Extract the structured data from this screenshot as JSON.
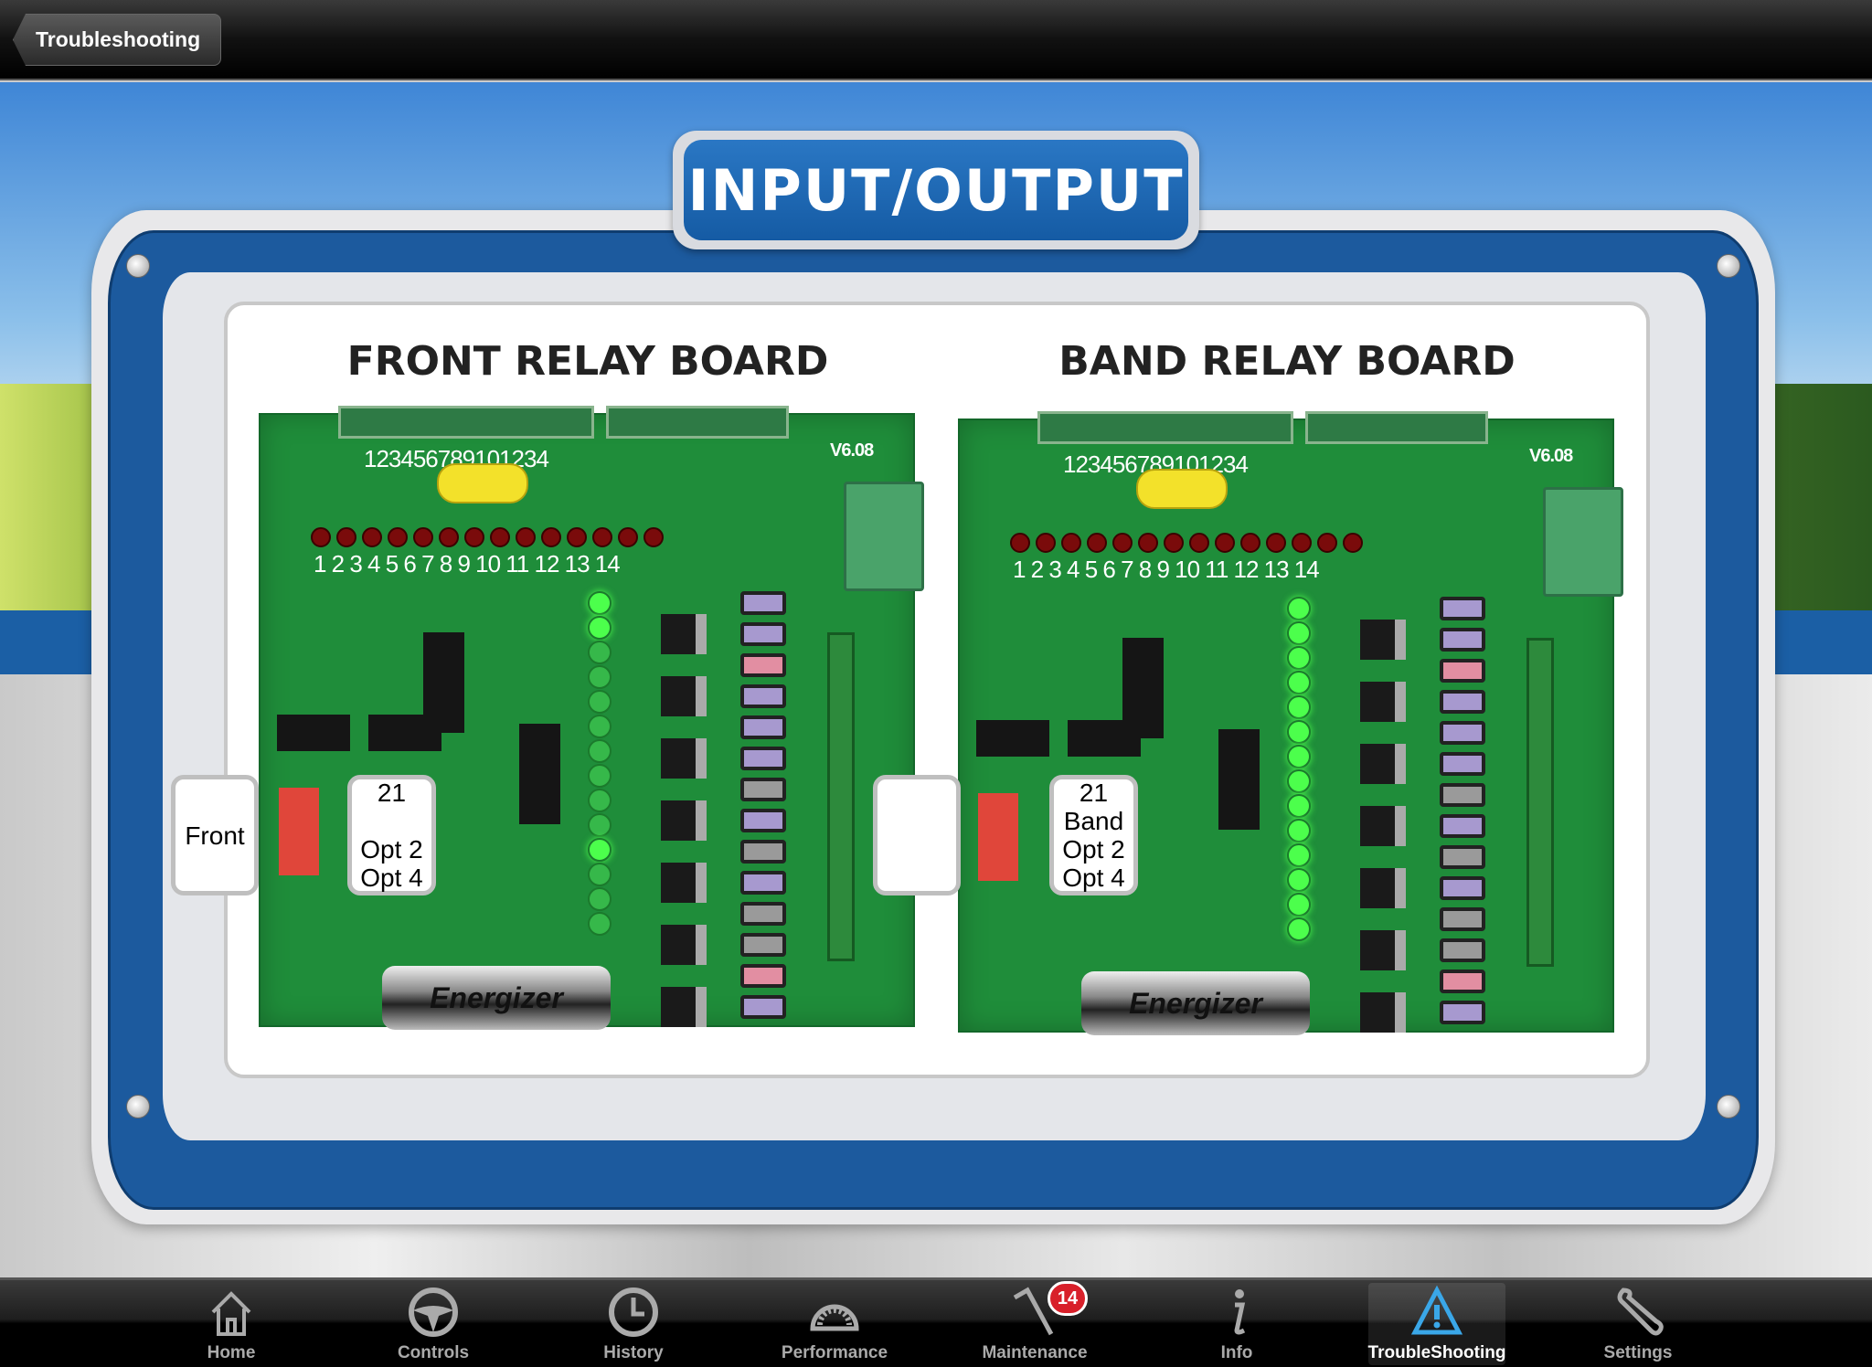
{
  "header": {
    "back_label": "Troubleshooting"
  },
  "title": "INPUT/OUTPUT",
  "boards": [
    {
      "title": "FRONT RELAY BOARD",
      "version": "V6.08",
      "battery": "Energizer",
      "callout_left": "Front",
      "callout_right": [
        "21",
        "",
        "Opt 2",
        "Opt 4"
      ],
      "green_leds_on": [
        1,
        2,
        11
      ]
    },
    {
      "title": "BAND RELAY BOARD",
      "version": "V6.08",
      "battery": "Energizer",
      "callout_left": "",
      "callout_right": [
        "21",
        "Band",
        "Opt 2",
        "Opt 4"
      ],
      "green_leds_on": [
        1,
        2,
        3,
        4,
        5,
        6,
        7,
        8,
        9,
        10,
        11,
        12,
        13,
        14
      ]
    }
  ],
  "tabs": [
    {
      "label": "Home",
      "icon": "home-icon"
    },
    {
      "label": "Controls",
      "icon": "steering-wheel-icon"
    },
    {
      "label": "History",
      "icon": "clock-icon"
    },
    {
      "label": "Performance",
      "icon": "gauge-icon"
    },
    {
      "label": "Maintenance",
      "icon": "tools-icon",
      "badge": "14"
    },
    {
      "label": "Info",
      "icon": "info-icon"
    },
    {
      "label": "TroubleShooting",
      "icon": "warning-icon",
      "selected": true
    },
    {
      "label": "Settings",
      "icon": "wrench-icon"
    }
  ],
  "colors": {
    "accent": "#1c5a9e",
    "selected_tab": "#3aa7e8",
    "badge": "#d8202a",
    "pcb": "#1f8d3a"
  }
}
